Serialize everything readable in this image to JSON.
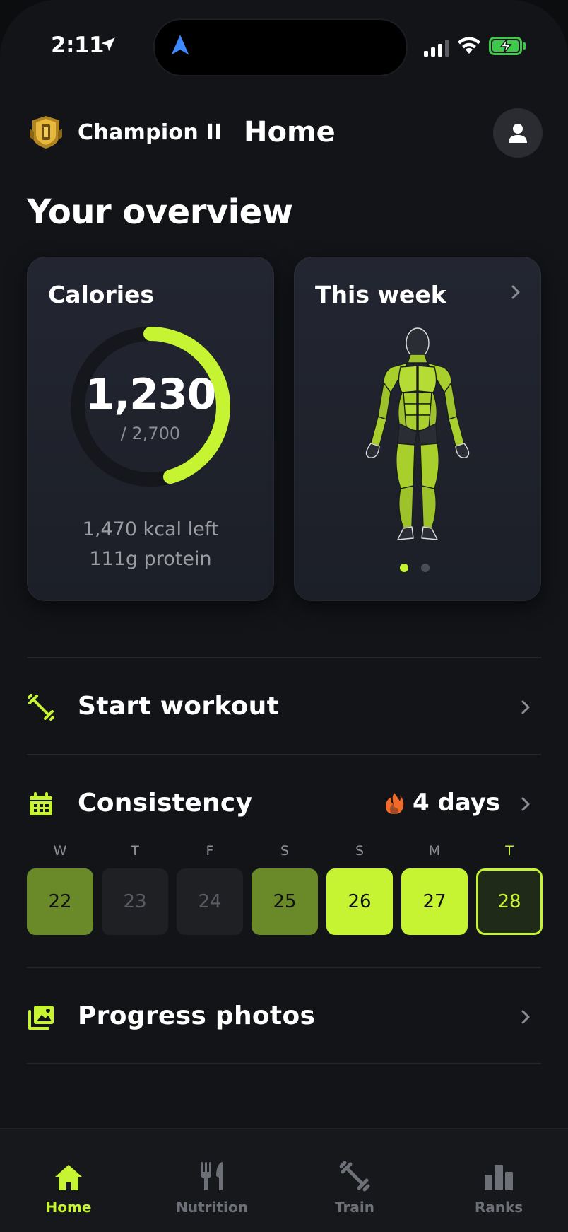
{
  "status_bar": {
    "time": "2:11"
  },
  "header": {
    "rank_name": "Champion II",
    "title": "Home"
  },
  "overview": {
    "title": "Your overview",
    "calories_card": {
      "title": "Calories",
      "value": "1,230",
      "goal": "/ 2,700",
      "left": "1,470 kcal left",
      "protein": "111g protein",
      "progress_fraction": 0.456
    },
    "week_card": {
      "title": "This week",
      "page_count": 2,
      "active_page": 1
    }
  },
  "start_workout": {
    "label": "Start workout"
  },
  "consistency": {
    "label": "Consistency",
    "streak": "4 days",
    "days": [
      {
        "letter": "W",
        "date": "22",
        "level": "low"
      },
      {
        "letter": "T",
        "date": "23",
        "level": "none"
      },
      {
        "letter": "F",
        "date": "24",
        "level": "none"
      },
      {
        "letter": "S",
        "date": "25",
        "level": "low"
      },
      {
        "letter": "S",
        "date": "26",
        "level": "high"
      },
      {
        "letter": "M",
        "date": "27",
        "level": "high"
      },
      {
        "letter": "T",
        "date": "28",
        "level": "today"
      }
    ]
  },
  "progress_photos": {
    "label": "Progress photos"
  },
  "tab_bar": {
    "tabs": [
      {
        "label": "Home",
        "icon": "home-icon",
        "active": true
      },
      {
        "label": "Nutrition",
        "icon": "fork-knife-icon",
        "active": false
      },
      {
        "label": "Train",
        "icon": "dumbbell-icon",
        "active": false
      },
      {
        "label": "Ranks",
        "icon": "bar-chart-icon",
        "active": false
      }
    ]
  },
  "colors": {
    "accent": "#c6f432",
    "accent_dim": "#6a8a2a",
    "background": "#131418",
    "card": "#1f222b",
    "flame": "#f06a2a"
  }
}
